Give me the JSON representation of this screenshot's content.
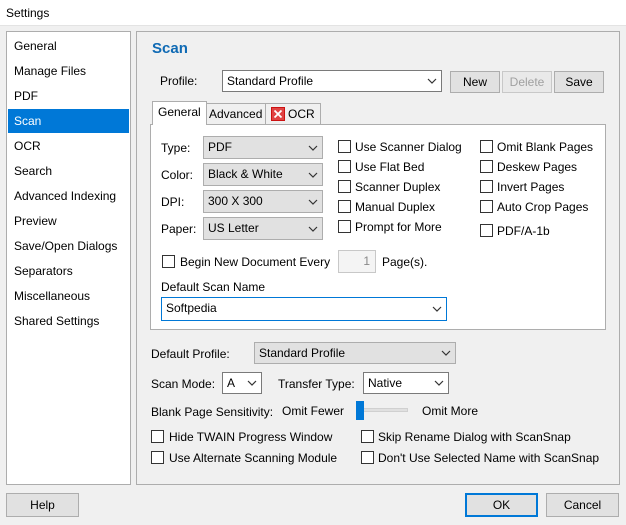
{
  "window": {
    "title": "Settings"
  },
  "sidebar": {
    "items": [
      {
        "label": "General"
      },
      {
        "label": "Manage Files"
      },
      {
        "label": "PDF"
      },
      {
        "label": "Scan",
        "selected": true
      },
      {
        "label": "OCR"
      },
      {
        "label": "Search"
      },
      {
        "label": "Advanced Indexing"
      },
      {
        "label": "Preview"
      },
      {
        "label": "Save/Open Dialogs"
      },
      {
        "label": "Separators"
      },
      {
        "label": "Miscellaneous"
      },
      {
        "label": "Shared Settings"
      }
    ]
  },
  "scan": {
    "title": "Scan",
    "profile_label": "Profile:",
    "profile_value": "Standard Profile",
    "new_label": "New",
    "delete_label": "Delete",
    "save_label": "Save",
    "tabs": [
      {
        "label": "General",
        "active": true
      },
      {
        "label": "Advanced"
      },
      {
        "label": "OCR",
        "icon": "red-x-icon"
      }
    ],
    "general": {
      "type_label": "Type:",
      "type_value": "PDF",
      "color_label": "Color:",
      "color_value": "Black & White",
      "dpi_label": "DPI:",
      "dpi_value": "300 X 300",
      "paper_label": "Paper:",
      "paper_value": "US Letter",
      "options_mid": [
        {
          "label": "Use Scanner Dialog",
          "checked": false
        },
        {
          "label": "Use Flat Bed",
          "checked": false
        },
        {
          "label": "Scanner Duplex",
          "checked": false
        },
        {
          "label": "Manual Duplex",
          "checked": false
        },
        {
          "label": "Prompt for More",
          "checked": false
        }
      ],
      "options_right": [
        {
          "label": "Omit Blank Pages",
          "checked": false
        },
        {
          "label": "Deskew Pages",
          "checked": false
        },
        {
          "label": "Invert Pages",
          "checked": false
        },
        {
          "label": "Auto Crop Pages",
          "checked": false
        },
        {
          "label": "PDF/A-1b",
          "checked": false
        }
      ],
      "begin_new_label": "Begin New Document Every",
      "begin_new_value": "1",
      "pages_label": "Page(s).",
      "default_name_label": "Default Scan Name",
      "default_name_value": "Softpedia"
    },
    "default_profile_label": "Default Profile:",
    "default_profile_value": "Standard Profile",
    "scan_mode_label": "Scan Mode:",
    "scan_mode_value": "A",
    "transfer_type_label": "Transfer Type:",
    "transfer_type_value": "Native",
    "blank_sensitivity_label": "Blank Page Sensitivity:",
    "omit_fewer_label": "Omit Fewer",
    "omit_more_label": "Omit More",
    "blank_sensitivity_level": 0.0,
    "bottom_options": [
      {
        "label": "Hide TWAIN Progress Window",
        "checked": false
      },
      {
        "label": "Skip Rename Dialog with ScanSnap",
        "checked": false
      },
      {
        "label": "Use Alternate Scanning Module",
        "checked": false
      },
      {
        "label": "Don't Use Selected Name with ScanSnap",
        "checked": false
      }
    ]
  },
  "footer": {
    "help_label": "Help",
    "ok_label": "OK",
    "cancel_label": "Cancel"
  },
  "colors": {
    "accent": "#0078d7",
    "title": "#0f6ab4",
    "ocr_icon": "#e04343"
  }
}
